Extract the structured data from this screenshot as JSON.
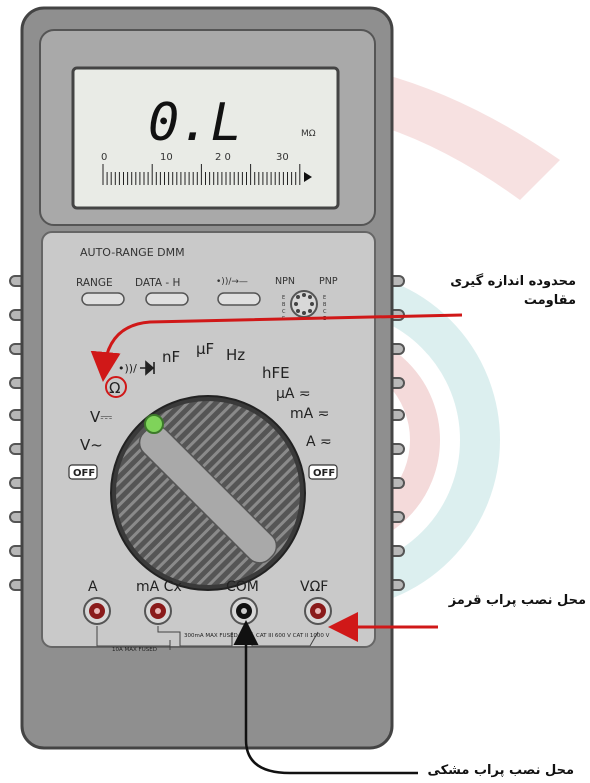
{
  "display": {
    "reading": "0.L",
    "unit": "MΩ",
    "scale_ticks": [
      "0",
      "10",
      "2 0",
      "30"
    ]
  },
  "meter": {
    "brand_label": "AUTO-RANGE DMM",
    "buttons": [
      "RANGE",
      "DATA - H",
      "•))/→—"
    ],
    "transistor_labels": [
      "NPN",
      "PNP"
    ],
    "socket_letters_left": [
      "E",
      "B",
      "C",
      "E"
    ],
    "socket_letters_right": [
      "E",
      "B",
      "C",
      "E"
    ]
  },
  "dial": {
    "positions_top": [
      "•))/",
      "nF",
      "µF",
      "Hz",
      "hFE"
    ],
    "ohm_symbol": "Ω",
    "left_labels": [
      "V⎓",
      "V~",
      "OFF"
    ],
    "right_labels": [
      "µA ≂",
      "mA ≂",
      "A ≂",
      "OFF"
    ]
  },
  "jacks": {
    "labels": [
      "A",
      "mA Cx",
      "COM",
      "VΩF"
    ],
    "fuse_notes": [
      "10A MAX\nFUSED",
      "300mA MAX\nFUSED",
      "CAT III 600 V\nCAT II 1000 V"
    ]
  },
  "annotations": {
    "resistance_range": "محدوده اندازه گیری\nمقاومت",
    "red_probe": "محل نصب پراب قرمز",
    "black_probe": "محل نصب پراب مشکی"
  },
  "colors": {
    "body": "#8f8f8f",
    "panel": "#c9c9c9",
    "lcd": "#e9ebe6",
    "arrow_red": "#d01818",
    "arrow_black": "#111111",
    "watermark": "#f2d2d2"
  }
}
